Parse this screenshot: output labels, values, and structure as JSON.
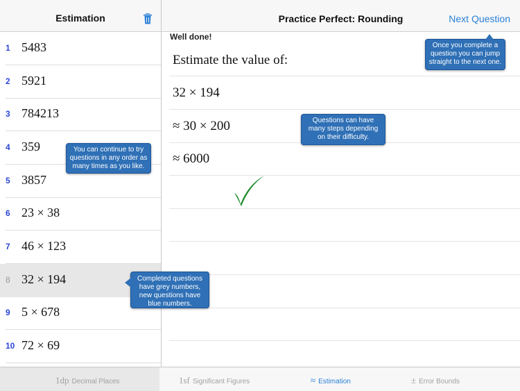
{
  "sidebar": {
    "title": "Estimation",
    "questions": [
      {
        "num": "1",
        "text": "5483",
        "done": false
      },
      {
        "num": "2",
        "text": "5921",
        "done": false
      },
      {
        "num": "3",
        "text": "784213",
        "done": false
      },
      {
        "num": "4",
        "text": "359",
        "done": false
      },
      {
        "num": "5",
        "text": "3857",
        "done": false
      },
      {
        "num": "6",
        "text": "23 × 38",
        "done": false
      },
      {
        "num": "7",
        "text": "46 × 123",
        "done": false
      },
      {
        "num": "8",
        "text": "32 × 194",
        "done": true
      },
      {
        "num": "9",
        "text": "5 × 678",
        "done": false
      },
      {
        "num": "10",
        "text": "72 × 69",
        "done": false
      }
    ]
  },
  "main": {
    "title": "Practice Perfect: Rounding",
    "next_label": "Next Question",
    "status": "Well done!",
    "steps": [
      "Estimate the value of:",
      "32 × 194",
      "≈ 30 × 200",
      "≈ 6000"
    ]
  },
  "tooltips": {
    "next": "Once you complete a question you can jump straight to the next one.",
    "steps": "Questions can have many steps depending on their difficulty.",
    "order": "You can continue to try questions in any order as many times as you like.",
    "colors": "Completed questions have grey numbers, new questions have blue numbers."
  },
  "tabs": [
    {
      "symbol": "1dp",
      "label": "Decimal Places",
      "active": false
    },
    {
      "symbol": "1sf",
      "label": "Significant Figures",
      "active": false
    },
    {
      "symbol": "≈",
      "label": "Estimation",
      "active": true
    },
    {
      "symbol": "±",
      "label": "Error Bounds",
      "active": false
    }
  ],
  "colors": {
    "accent": "#2a80d6",
    "tooltip": "#2f70b6",
    "check": "#1a8a2a",
    "new_number": "#2d47d8",
    "done_number": "#9a9a9a"
  }
}
